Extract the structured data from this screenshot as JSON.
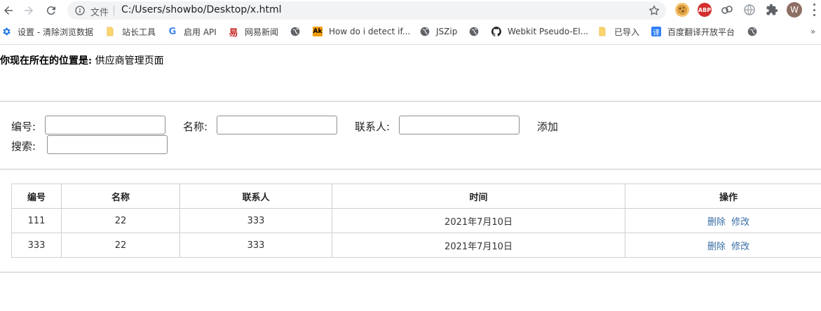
{
  "browser": {
    "omnibox_label": "文件",
    "url": "C:/Users/showbo/Desktop/x.html",
    "profile_initial": "W",
    "extensions": [
      "cookie-icon",
      "adblock-icon",
      "link-icon",
      "globe-extension-icon",
      "puzzle-icon"
    ],
    "ext_abp_label": "ABP",
    "bookmarks": [
      {
        "label": "设置 - 清除浏览数据",
        "icon": "gear-icon"
      },
      {
        "label": "站长工具",
        "icon": "folder-icon"
      },
      {
        "label": "启用 API",
        "icon": "google-icon"
      },
      {
        "label": "网易新闻",
        "icon": "netease-icon"
      },
      {
        "label": "",
        "icon": "globe-icon"
      },
      {
        "label": "How do i detect if...",
        "icon": "ak-icon"
      },
      {
        "label": "JSZip",
        "icon": "globe-icon"
      },
      {
        "label": "",
        "icon": "globe-icon"
      },
      {
        "label": "Webkit Pseudo-El...",
        "icon": "github-icon"
      },
      {
        "label": "已导入",
        "icon": "folder-icon"
      },
      {
        "label": "百度翻译开放平台",
        "icon": "translate-icon"
      },
      {
        "label": "",
        "icon": "globe-icon"
      }
    ],
    "bookmark_icon_text": {
      "ak": "Ak",
      "translate": "译",
      "google": "G",
      "netease": "易"
    },
    "bookmarks_more": "»"
  },
  "page": {
    "location_label": "你现在所在的位置是:",
    "location_value": "供应商管理页面",
    "form": {
      "id_label": "编号:",
      "id_value": "",
      "name_label": "名称:",
      "name_value": "",
      "contact_label": "联系人:",
      "contact_value": "",
      "add_label": "添加",
      "search_label": "搜索:",
      "search_value": ""
    },
    "table": {
      "headers": [
        "编号",
        "名称",
        "联系人",
        "时间",
        "操作"
      ],
      "rows": [
        {
          "id": "111",
          "name": "22",
          "contact": "333",
          "time": "2021年7月10日",
          "delete": "删除",
          "edit": "修改"
        },
        {
          "id": "333",
          "name": "22",
          "contact": "333",
          "time": "2021年7月10日",
          "delete": "删除",
          "edit": "修改"
        }
      ]
    }
  },
  "colors": {
    "link": "#3a6ea5",
    "border": "#d0d0d0",
    "avatar": "#8d6e63",
    "abp_red": "#d32f2f"
  }
}
